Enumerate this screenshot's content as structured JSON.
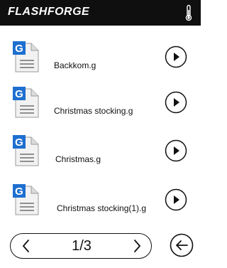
{
  "header": {
    "brand": "FLASHFORGE",
    "thermometer_icon": "thermometer-icon"
  },
  "files": [
    {
      "name": "Backkom.g",
      "file_icon": "gcode-file-icon",
      "action_icon": "play-icon"
    },
    {
      "name": "Christmas stocking.g",
      "file_icon": "gcode-file-icon",
      "action_icon": "play-icon"
    },
    {
      "name": "Christmas.g",
      "file_icon": "gcode-file-icon",
      "action_icon": "play-icon"
    },
    {
      "name": "Christmas stocking(1).g",
      "file_icon": "gcode-file-icon",
      "action_icon": "play-icon"
    }
  ],
  "file_icon_letter": "G",
  "pager": {
    "label": "1/3",
    "prev_icon": "chevron-left-icon",
    "next_icon": "chevron-right-icon"
  },
  "back_icon": "arrow-left-icon",
  "colors": {
    "topbar": "#0f0f0f",
    "file_icon_blue": "#1e6fd0",
    "text": "#111111"
  }
}
